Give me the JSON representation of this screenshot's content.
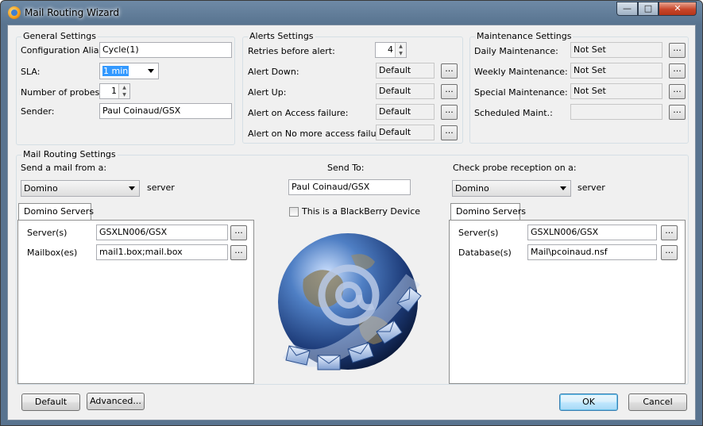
{
  "window": {
    "title": "Mail Routing Wizard",
    "close_glyph": "✕",
    "minimize_glyph": "—",
    "maximize_glyph": "□"
  },
  "general": {
    "legend": "General Settings",
    "alias_label": "Configuration Alias:",
    "alias_value": "Cycle(1)",
    "sla_label": "SLA:",
    "sla_value": "1 min",
    "probes_label": "Number of probes:",
    "probes_value": "1",
    "sender_label": "Sender:",
    "sender_value": "Paul Coinaud/GSX"
  },
  "alerts": {
    "legend": "Alerts Settings",
    "retries_label": "Retries before alert:",
    "retries_value": "4",
    "rows": [
      {
        "label": "Alert Down:",
        "value": "Default"
      },
      {
        "label": "Alert Up:",
        "value": "Default"
      },
      {
        "label": "Alert on Access failure:",
        "value": "Default"
      },
      {
        "label": "Alert on No more access failure:",
        "value": "Default"
      }
    ]
  },
  "maintenance": {
    "legend": "Maintenance Settings",
    "rows": [
      {
        "label": "Daily Maintenance:",
        "value": "Not Set"
      },
      {
        "label": "Weekly Maintenance:",
        "value": "Not Set"
      },
      {
        "label": "Special Maintenance:",
        "value": "Not Set"
      },
      {
        "label": "Scheduled Maint.:",
        "value": ""
      }
    ]
  },
  "routing": {
    "legend": "Mail Routing Settings",
    "from_label": "Send a mail from a:",
    "from_value": "Domino",
    "from_suffix": "server",
    "sendto_label": "Send To:",
    "sendto_value": "Paul Coinaud/GSX",
    "blackberry_label": "This is a BlackBerry Device",
    "blackberry_checked": false,
    "check_label": "Check probe reception on a:",
    "check_value": "Domino",
    "check_suffix": "server",
    "left_tab": "Domino Servers",
    "left_server_label": "Server(s)",
    "left_server_value": "GSXLN006/GSX",
    "left_mailbox_label": "Mailbox(es)",
    "left_mailbox_value": "mail1.box;mail.box",
    "right_tab": "Domino Servers",
    "right_server_label": "Server(s)",
    "right_server_value": "GSXLN006/GSX",
    "right_db_label": "Database(s)",
    "right_db_value": "Mail\\pcoinaud.nsf"
  },
  "ellipsis": "...",
  "buttons": {
    "default": "Default",
    "advanced": "Advanced...",
    "ok": "OK",
    "cancel": "Cancel"
  },
  "colors": {
    "titlebar": "#58738f",
    "client": "#f0f0f0",
    "selection": "#3399ff"
  }
}
